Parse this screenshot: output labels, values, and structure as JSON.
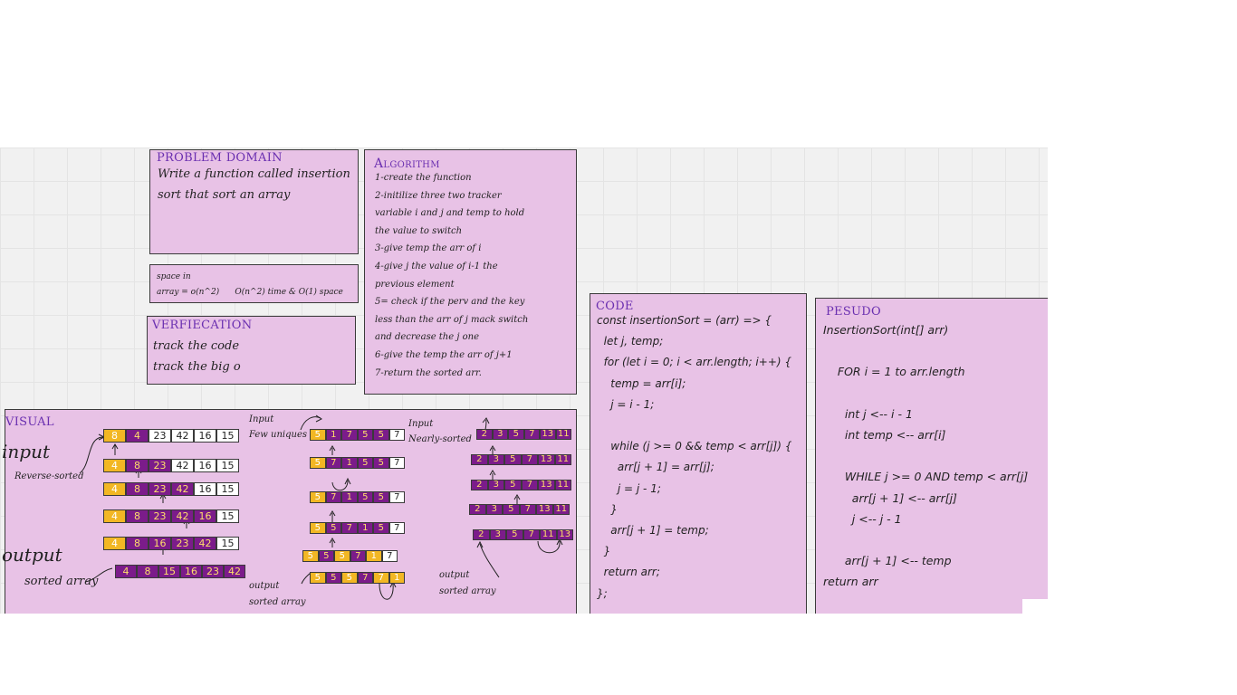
{
  "problem_domain": {
    "title": "PROBLEM DOMAIN",
    "lines": [
      "Write a function called insertion",
      "sort that sort an array"
    ]
  },
  "complexity": {
    "line1": "space in",
    "line2": "array = o(n^2)      O(n^2) time & O(1) space"
  },
  "verification": {
    "title": "VERFIECATION",
    "lines": [
      "track the code",
      "track the big o"
    ]
  },
  "algorithm": {
    "title": "Algorithm",
    "lines": [
      "1-create the function",
      "2-initilize three two tracker",
      "variable i and j and temp to hold",
      "the value to switch",
      "3-give temp the arr of i",
      "4-give j the value of i-1 the",
      "previous element",
      "5= check if the perv and the key",
      "less than the arr of j mack switch",
      "and decrease the j one",
      "6-give the temp the arr of j+1",
      "7-return the sorted arr."
    ]
  },
  "code": {
    "title": "CODE",
    "lines": [
      "const insertionSort = (arr) => {",
      "  let j, temp;",
      "  for (let i = 0; i < arr.length; i++) {",
      "    temp = arr[i];",
      "    j = i - 1;",
      "",
      "    while (j >= 0 && temp < arr[j]) {",
      "      arr[j + 1] = arr[j];",
      "      j = j - 1;",
      "    }",
      "    arr[j + 1] = temp;",
      "  }",
      "  return arr;",
      "};"
    ]
  },
  "pseudo": {
    "title": "PESUDO",
    "lines": [
      "InsertionSort(int[] arr)",
      "",
      "    FOR i = 1 to arr.length",
      "",
      "      int j <-- i - 1",
      "      int temp <-- arr[i]",
      "",
      "      WHILE j >= 0 AND temp < arr[j]",
      "        arr[j + 1] <-- arr[j]",
      "        j <-- j - 1",
      "",
      "      arr[j + 1] <-- temp",
      "return arr"
    ]
  },
  "visual": {
    "title": "VISUAL",
    "input_label": "input",
    "reverse_label": "Reverse-sorted",
    "output_label": "output",
    "sorted_label": "sorted array",
    "few_input_label": "Input",
    "few_unique_label": "Few uniques",
    "few_output_label": "output",
    "few_sorted_label": "sorted array",
    "nearly_input_label": "Input",
    "nearly_label": "Nearly-sorted",
    "nearly_output_label": "output",
    "nearly_sorted_label": "sorted array",
    "reverse_rows": [
      [
        [
          "8",
          "y"
        ],
        [
          "4",
          "p"
        ],
        [
          "23",
          "w"
        ],
        [
          "42",
          "w"
        ],
        [
          "16",
          "w"
        ],
        [
          "15",
          "w"
        ]
      ],
      [
        [
          "4",
          "y"
        ],
        [
          "8",
          "p"
        ],
        [
          "23",
          "p"
        ],
        [
          "42",
          "w"
        ],
        [
          "16",
          "w"
        ],
        [
          "15",
          "w"
        ]
      ],
      [
        [
          "4",
          "y"
        ],
        [
          "8",
          "p"
        ],
        [
          "23",
          "p"
        ],
        [
          "42",
          "p"
        ],
        [
          "16",
          "w"
        ],
        [
          "15",
          "w"
        ]
      ],
      [
        [
          "4",
          "y"
        ],
        [
          "8",
          "p"
        ],
        [
          "23",
          "p"
        ],
        [
          "42",
          "p"
        ],
        [
          "16",
          "p"
        ],
        [
          "15",
          "w"
        ]
      ],
      [
        [
          "4",
          "y"
        ],
        [
          "8",
          "p"
        ],
        [
          "16",
          "p"
        ],
        [
          "23",
          "p"
        ],
        [
          "42",
          "p"
        ],
        [
          "15",
          "w"
        ]
      ],
      [
        [
          "4",
          "p"
        ],
        [
          "8",
          "p"
        ],
        [
          "15",
          "p"
        ],
        [
          "16",
          "p"
        ],
        [
          "23",
          "p"
        ],
        [
          "42",
          "p"
        ]
      ]
    ],
    "few_rows": [
      [
        [
          "5",
          "y"
        ],
        [
          "1",
          "p"
        ],
        [
          "7",
          "p"
        ],
        [
          "5",
          "p"
        ],
        [
          "5",
          "p"
        ],
        [
          "7",
          "w"
        ]
      ],
      [
        [
          "5",
          "y"
        ],
        [
          "7",
          "p"
        ],
        [
          "1",
          "p"
        ],
        [
          "5",
          "p"
        ],
        [
          "5",
          "p"
        ],
        [
          "7",
          "w"
        ]
      ],
      [
        [
          "5",
          "y"
        ],
        [
          "7",
          "p"
        ],
        [
          "1",
          "p"
        ],
        [
          "5",
          "p"
        ],
        [
          "5",
          "p"
        ],
        [
          "7",
          "w"
        ]
      ],
      [
        [
          "5",
          "y"
        ],
        [
          "5",
          "p"
        ],
        [
          "7",
          "p"
        ],
        [
          "1",
          "p"
        ],
        [
          "5",
          "p"
        ],
        [
          "7",
          "w"
        ]
      ],
      [
        [
          "5",
          "y"
        ],
        [
          "5",
          "p"
        ],
        [
          "5",
          "y"
        ],
        [
          "7",
          "p"
        ],
        [
          "1",
          "y"
        ],
        [
          "7",
          "w"
        ]
      ],
      [
        [
          "5",
          "y"
        ],
        [
          "5",
          "p"
        ],
        [
          "5",
          "y"
        ],
        [
          "7",
          "p"
        ],
        [
          "7",
          "y"
        ],
        [
          "1",
          "y"
        ]
      ]
    ],
    "nearly_rows": [
      [
        [
          "2",
          "p"
        ],
        [
          "3",
          "p"
        ],
        [
          "5",
          "p"
        ],
        [
          "7",
          "p"
        ],
        [
          "13",
          "p"
        ],
        [
          "11",
          "p"
        ]
      ],
      [
        [
          "2",
          "p"
        ],
        [
          "3",
          "p"
        ],
        [
          "5",
          "p"
        ],
        [
          "7",
          "p"
        ],
        [
          "13",
          "p"
        ],
        [
          "11",
          "p"
        ]
      ],
      [
        [
          "2",
          "p"
        ],
        [
          "3",
          "p"
        ],
        [
          "5",
          "p"
        ],
        [
          "7",
          "p"
        ],
        [
          "13",
          "p"
        ],
        [
          "11",
          "p"
        ]
      ],
      [
        [
          "2",
          "p"
        ],
        [
          "3",
          "p"
        ],
        [
          "5",
          "p"
        ],
        [
          "7",
          "p"
        ],
        [
          "13",
          "p"
        ],
        [
          "11",
          "p"
        ]
      ],
      [
        [
          "2",
          "p"
        ],
        [
          "3",
          "p"
        ],
        [
          "5",
          "p"
        ],
        [
          "7",
          "p"
        ],
        [
          "11",
          "p"
        ],
        [
          "13",
          "p"
        ]
      ]
    ]
  },
  "colors": {
    "panel": "#e8c2e6",
    "title": "#6a2fb0",
    "yellow_cell": "#f2b724",
    "purple_cell": "#7b1c8a",
    "board": "#f1f1f1"
  }
}
